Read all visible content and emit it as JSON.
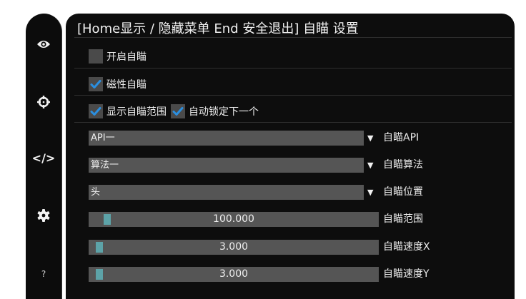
{
  "window": {
    "title": "[Home显示 / 隐藏菜单  End 安全退出] 自瞄 设置"
  },
  "sidebar": {
    "items": [
      {
        "icon": "eye-icon"
      },
      {
        "icon": "crosshair-icon"
      },
      {
        "icon": "code-icon",
        "glyph": "</>"
      },
      {
        "icon": "gear-icon"
      },
      {
        "icon": "help-icon",
        "glyph": "?"
      }
    ]
  },
  "settings": {
    "enable_aim": {
      "label": "开启自瞄",
      "checked": false
    },
    "magnetic_aim": {
      "label": "磁性自瞄",
      "checked": true
    },
    "show_aim_range": {
      "label": "显示自瞄范围",
      "checked": true
    },
    "auto_lock_next": {
      "label": "自动锁定下一个",
      "checked": true
    },
    "aim_api": {
      "label": "自瞄API",
      "value": "API一"
    },
    "aim_algorithm": {
      "label": "自瞄算法",
      "value": "算法一"
    },
    "aim_position": {
      "label": "自瞄位置",
      "value": "头"
    },
    "aim_range": {
      "label": "自瞄范围",
      "value": "100.000"
    },
    "aim_speed_x": {
      "label": "自瞄速度X",
      "value": "3.000"
    },
    "aim_speed_y": {
      "label": "自瞄速度Y",
      "value": "3.000"
    }
  },
  "colors": {
    "accent": "#2a8fe0",
    "slider_grab": "#5da3a8",
    "control_bg": "#555555",
    "panel_bg": "#0d0d0d"
  }
}
